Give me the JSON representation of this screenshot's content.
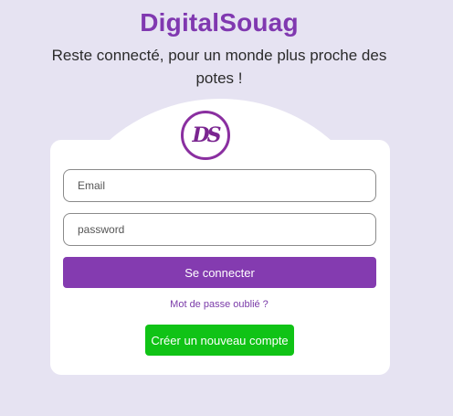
{
  "header": {
    "title": "DigitalSouag",
    "tagline": "Reste connecté, pour un monde plus proche des potes !"
  },
  "logo": {
    "text": "DS"
  },
  "login_form": {
    "email_placeholder": "Email",
    "password_placeholder": "password",
    "submit_label": "Se connecter",
    "forgot_password": "Mot de passe oublié ?",
    "create_account_label": "Créer un nouveau compte"
  },
  "colors": {
    "brand": "#8038b0",
    "primary_button": "#843bb0",
    "create_button": "#10c316",
    "background": "#e6e3f2"
  }
}
